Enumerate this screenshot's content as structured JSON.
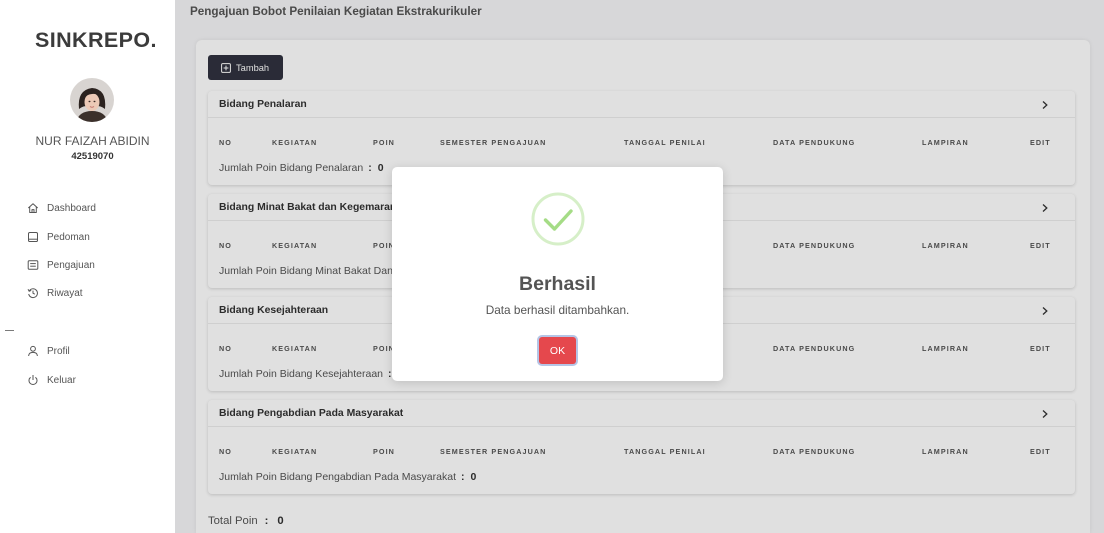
{
  "app": {
    "logo": "SINKREPO."
  },
  "user": {
    "name": "NUR FAIZAH ABIDIN",
    "id": "42519070"
  },
  "sidebar": {
    "menu": [
      {
        "label": "Dashboard",
        "icon": "home-icon"
      },
      {
        "label": "Pedoman",
        "icon": "book-icon"
      },
      {
        "label": "Pengajuan",
        "icon": "form-icon"
      },
      {
        "label": "Riwayat",
        "icon": "history-icon"
      }
    ],
    "account_menu": [
      {
        "label": "Profil",
        "icon": "user-icon"
      },
      {
        "label": "Keluar",
        "icon": "power-icon"
      }
    ]
  },
  "page": {
    "title": "Pengajuan Bobot Penilaian Kegiatan Ekstrakurikuler",
    "add_button": {
      "label": "Tambah",
      "icon": "plus-square-icon"
    }
  },
  "table_columns": [
    "NO",
    "KEGIATAN",
    "POIN",
    "SEMESTER PENGAJUAN",
    "TANGGAL PENILAI",
    "DATA PENDUKUNG",
    "LAMPIRAN",
    "EDIT"
  ],
  "sections": [
    {
      "title": "Bidang Penalaran",
      "total_label": "Jumlah Poin Bidang Penalaran",
      "separator": ":",
      "total_value": "0"
    },
    {
      "title": "Bidang Minat Bakat dan Kegemaran",
      "total_label": "Jumlah Poin Bidang Minat Bakat Dan"
    },
    {
      "title": "Bidang Kesejahteraan",
      "total_label": "Jumlah Poin Bidang Kesejahteraan",
      "separator": ":"
    },
    {
      "title": "Bidang Pengabdian Pada Masyarakat",
      "total_label": "Jumlah Poin Bidang Pengabdian Pada Masyarakat",
      "separator": ":",
      "total_value": "0"
    }
  ],
  "total": {
    "label": "Total Poin",
    "separator": ":",
    "value": "0"
  },
  "modal": {
    "icon": "success-check-icon",
    "title": "Berhasil",
    "message": "Data berhasil ditambahkan.",
    "confirm_label": "OK"
  },
  "colors": {
    "confirm_button": "#e5484d",
    "add_button": "#30323f",
    "success": "#a5dc86",
    "text_muted": "#555555"
  }
}
